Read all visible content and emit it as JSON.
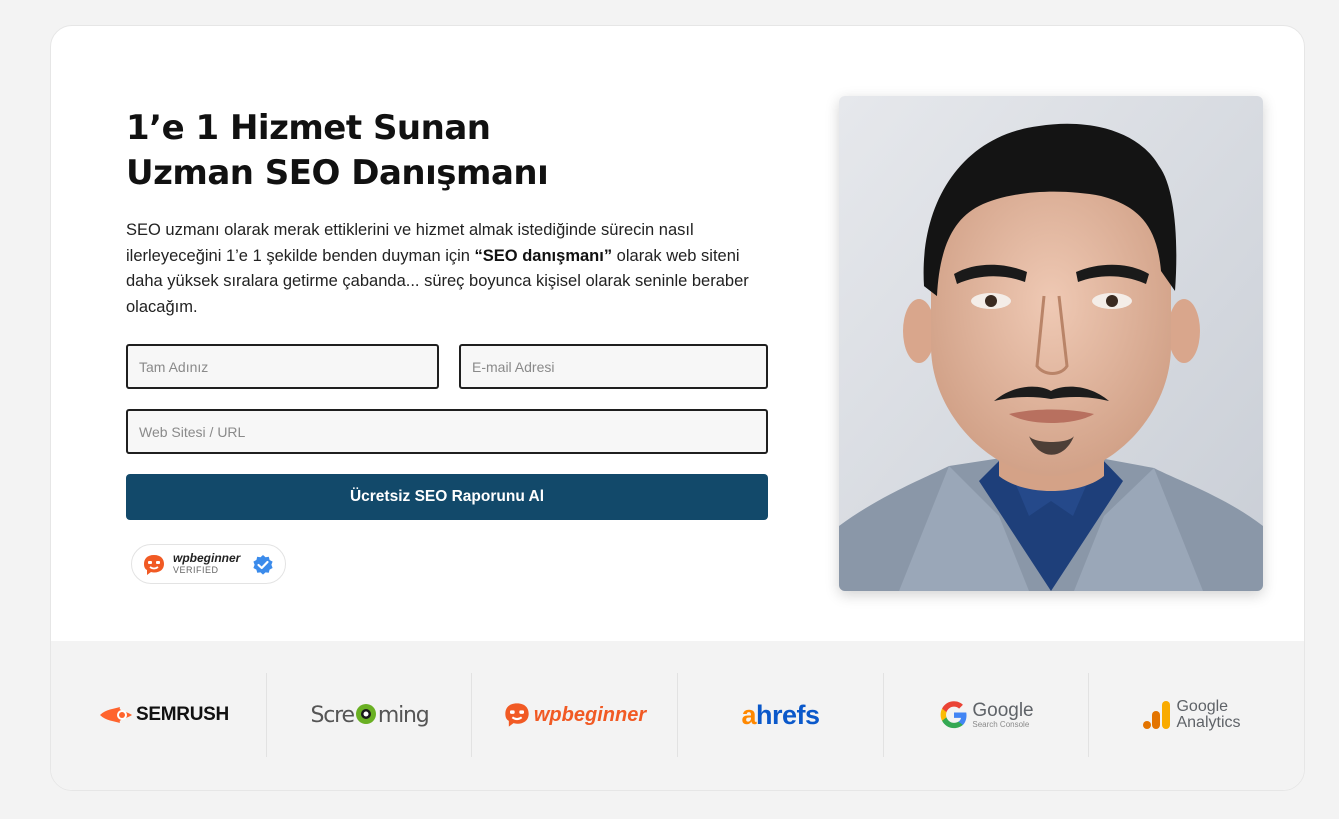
{
  "hero": {
    "title_line1": "1’e 1 Hizmet Sunan",
    "title_line2": "Uzman SEO Danışmanı",
    "description_part1": "SEO uzmanı olarak merak ettiklerini ve hizmet almak istediğinde sürecin nasıl ilerleyeceğini 1’e 1 şekilde benden duyman için ",
    "description_bold": "“SEO danışmanı”",
    "description_part2": " olarak web siteni daha yüksek sıralara getirme çabanda... süreç boyunca kişisel olarak seninle beraber olacağım."
  },
  "form": {
    "name_placeholder": "Tam Adınız",
    "email_placeholder": "E-mail Adresi",
    "url_placeholder": "Web Sitesi / URL",
    "submit_label": "Ücretsiz SEO Raporunu Al"
  },
  "badge": {
    "name": "wpbeginner",
    "status": "VERIFIED"
  },
  "logos": {
    "semrush": "SEMRUSH",
    "screaming_frog_pre": "Scre",
    "screaming_frog_post": "ming",
    "wpbeginner": "wpbeginner",
    "ahrefs_a": "a",
    "ahrefs_rest": "hrefs",
    "gsc_main": "Google",
    "gsc_sub": "Search Console",
    "ga_line1": "Google",
    "ga_line2": "Analytics"
  },
  "colors": {
    "cta": "#12496a",
    "semrush": "#ff642d",
    "wpbeginner": "#f15a24",
    "ahrefs_blue": "#0a58ca",
    "ahrefs_orange": "#ff8800",
    "ga_orange": "#f9ab00",
    "ga_dark_orange": "#e37400"
  }
}
